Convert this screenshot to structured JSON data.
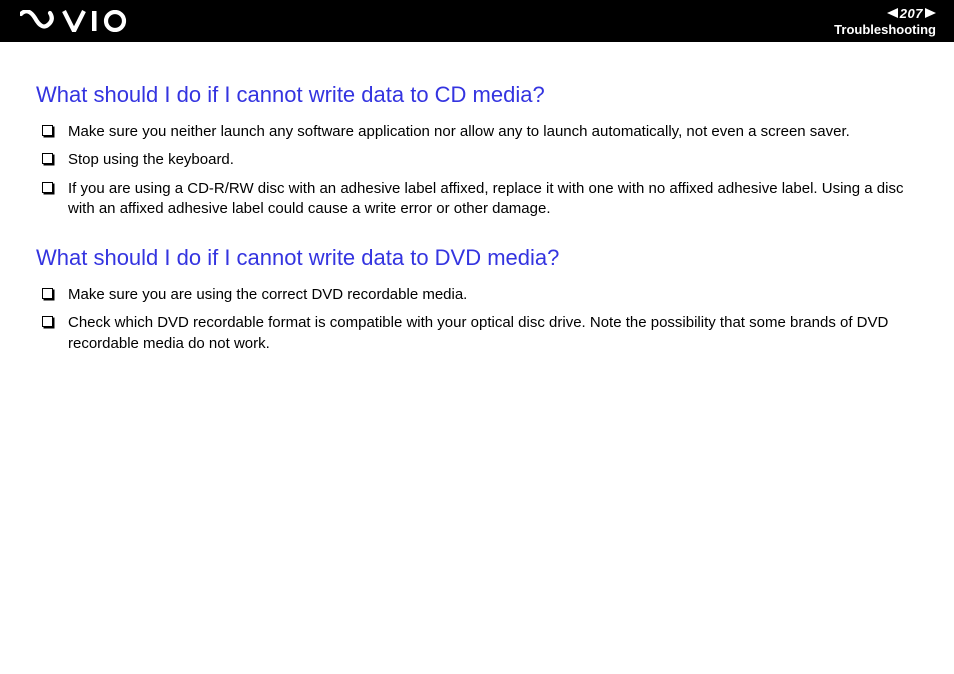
{
  "header": {
    "page_number": "207",
    "section": "Troubleshooting"
  },
  "sections": [
    {
      "heading": "What should I do if I cannot write data to CD media?",
      "items": [
        "Make sure you neither launch any software application nor allow any to launch automatically, not even a screen saver.",
        "Stop using the keyboard.",
        "If you are using a CD-R/RW disc with an adhesive label affixed, replace it with one with no affixed adhesive label. Using a disc with an affixed adhesive label could cause a write error or other damage."
      ]
    },
    {
      "heading": "What should I do if I cannot write data to DVD media?",
      "items": [
        "Make sure you are using the correct DVD recordable media.",
        "Check which DVD recordable format is compatible with your optical disc drive. Note the possibility that some brands of DVD recordable media do not work."
      ]
    }
  ]
}
